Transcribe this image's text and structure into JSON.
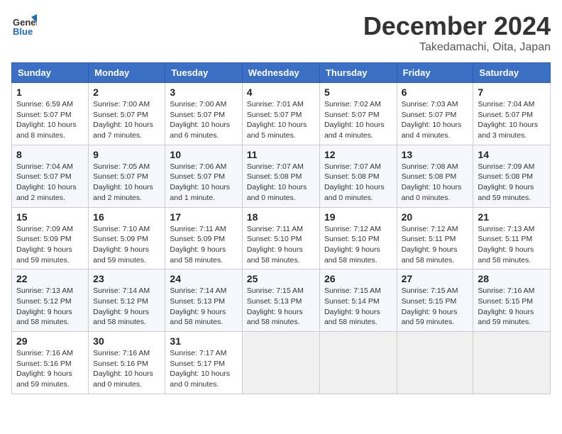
{
  "header": {
    "logo_line1": "General",
    "logo_line2": "Blue",
    "month": "December 2024",
    "location": "Takedamachi, Oita, Japan"
  },
  "weekdays": [
    "Sunday",
    "Monday",
    "Tuesday",
    "Wednesday",
    "Thursday",
    "Friday",
    "Saturday"
  ],
  "weeks": [
    [
      {
        "day": "1",
        "info": "Sunrise: 6:59 AM\nSunset: 5:07 PM\nDaylight: 10 hours\nand 8 minutes."
      },
      {
        "day": "2",
        "info": "Sunrise: 7:00 AM\nSunset: 5:07 PM\nDaylight: 10 hours\nand 7 minutes."
      },
      {
        "day": "3",
        "info": "Sunrise: 7:00 AM\nSunset: 5:07 PM\nDaylight: 10 hours\nand 6 minutes."
      },
      {
        "day": "4",
        "info": "Sunrise: 7:01 AM\nSunset: 5:07 PM\nDaylight: 10 hours\nand 5 minutes."
      },
      {
        "day": "5",
        "info": "Sunrise: 7:02 AM\nSunset: 5:07 PM\nDaylight: 10 hours\nand 4 minutes."
      },
      {
        "day": "6",
        "info": "Sunrise: 7:03 AM\nSunset: 5:07 PM\nDaylight: 10 hours\nand 4 minutes."
      },
      {
        "day": "7",
        "info": "Sunrise: 7:04 AM\nSunset: 5:07 PM\nDaylight: 10 hours\nand 3 minutes."
      }
    ],
    [
      {
        "day": "8",
        "info": "Sunrise: 7:04 AM\nSunset: 5:07 PM\nDaylight: 10 hours\nand 2 minutes."
      },
      {
        "day": "9",
        "info": "Sunrise: 7:05 AM\nSunset: 5:07 PM\nDaylight: 10 hours\nand 2 minutes."
      },
      {
        "day": "10",
        "info": "Sunrise: 7:06 AM\nSunset: 5:07 PM\nDaylight: 10 hours\nand 1 minute."
      },
      {
        "day": "11",
        "info": "Sunrise: 7:07 AM\nSunset: 5:08 PM\nDaylight: 10 hours\nand 0 minutes."
      },
      {
        "day": "12",
        "info": "Sunrise: 7:07 AM\nSunset: 5:08 PM\nDaylight: 10 hours\nand 0 minutes."
      },
      {
        "day": "13",
        "info": "Sunrise: 7:08 AM\nSunset: 5:08 PM\nDaylight: 10 hours\nand 0 minutes."
      },
      {
        "day": "14",
        "info": "Sunrise: 7:09 AM\nSunset: 5:08 PM\nDaylight: 9 hours\nand 59 minutes."
      }
    ],
    [
      {
        "day": "15",
        "info": "Sunrise: 7:09 AM\nSunset: 5:09 PM\nDaylight: 9 hours\nand 59 minutes."
      },
      {
        "day": "16",
        "info": "Sunrise: 7:10 AM\nSunset: 5:09 PM\nDaylight: 9 hours\nand 59 minutes."
      },
      {
        "day": "17",
        "info": "Sunrise: 7:11 AM\nSunset: 5:09 PM\nDaylight: 9 hours\nand 58 minutes."
      },
      {
        "day": "18",
        "info": "Sunrise: 7:11 AM\nSunset: 5:10 PM\nDaylight: 9 hours\nand 58 minutes."
      },
      {
        "day": "19",
        "info": "Sunrise: 7:12 AM\nSunset: 5:10 PM\nDaylight: 9 hours\nand 58 minutes."
      },
      {
        "day": "20",
        "info": "Sunrise: 7:12 AM\nSunset: 5:11 PM\nDaylight: 9 hours\nand 58 minutes."
      },
      {
        "day": "21",
        "info": "Sunrise: 7:13 AM\nSunset: 5:11 PM\nDaylight: 9 hours\nand 58 minutes."
      }
    ],
    [
      {
        "day": "22",
        "info": "Sunrise: 7:13 AM\nSunset: 5:12 PM\nDaylight: 9 hours\nand 58 minutes."
      },
      {
        "day": "23",
        "info": "Sunrise: 7:14 AM\nSunset: 5:12 PM\nDaylight: 9 hours\nand 58 minutes."
      },
      {
        "day": "24",
        "info": "Sunrise: 7:14 AM\nSunset: 5:13 PM\nDaylight: 9 hours\nand 58 minutes."
      },
      {
        "day": "25",
        "info": "Sunrise: 7:15 AM\nSunset: 5:13 PM\nDaylight: 9 hours\nand 58 minutes."
      },
      {
        "day": "26",
        "info": "Sunrise: 7:15 AM\nSunset: 5:14 PM\nDaylight: 9 hours\nand 58 minutes."
      },
      {
        "day": "27",
        "info": "Sunrise: 7:15 AM\nSunset: 5:15 PM\nDaylight: 9 hours\nand 59 minutes."
      },
      {
        "day": "28",
        "info": "Sunrise: 7:16 AM\nSunset: 5:15 PM\nDaylight: 9 hours\nand 59 minutes."
      }
    ],
    [
      {
        "day": "29",
        "info": "Sunrise: 7:16 AM\nSunset: 5:16 PM\nDaylight: 9 hours\nand 59 minutes."
      },
      {
        "day": "30",
        "info": "Sunrise: 7:16 AM\nSunset: 5:16 PM\nDaylight: 10 hours\nand 0 minutes."
      },
      {
        "day": "31",
        "info": "Sunrise: 7:17 AM\nSunset: 5:17 PM\nDaylight: 10 hours\nand 0 minutes."
      },
      null,
      null,
      null,
      null
    ]
  ]
}
